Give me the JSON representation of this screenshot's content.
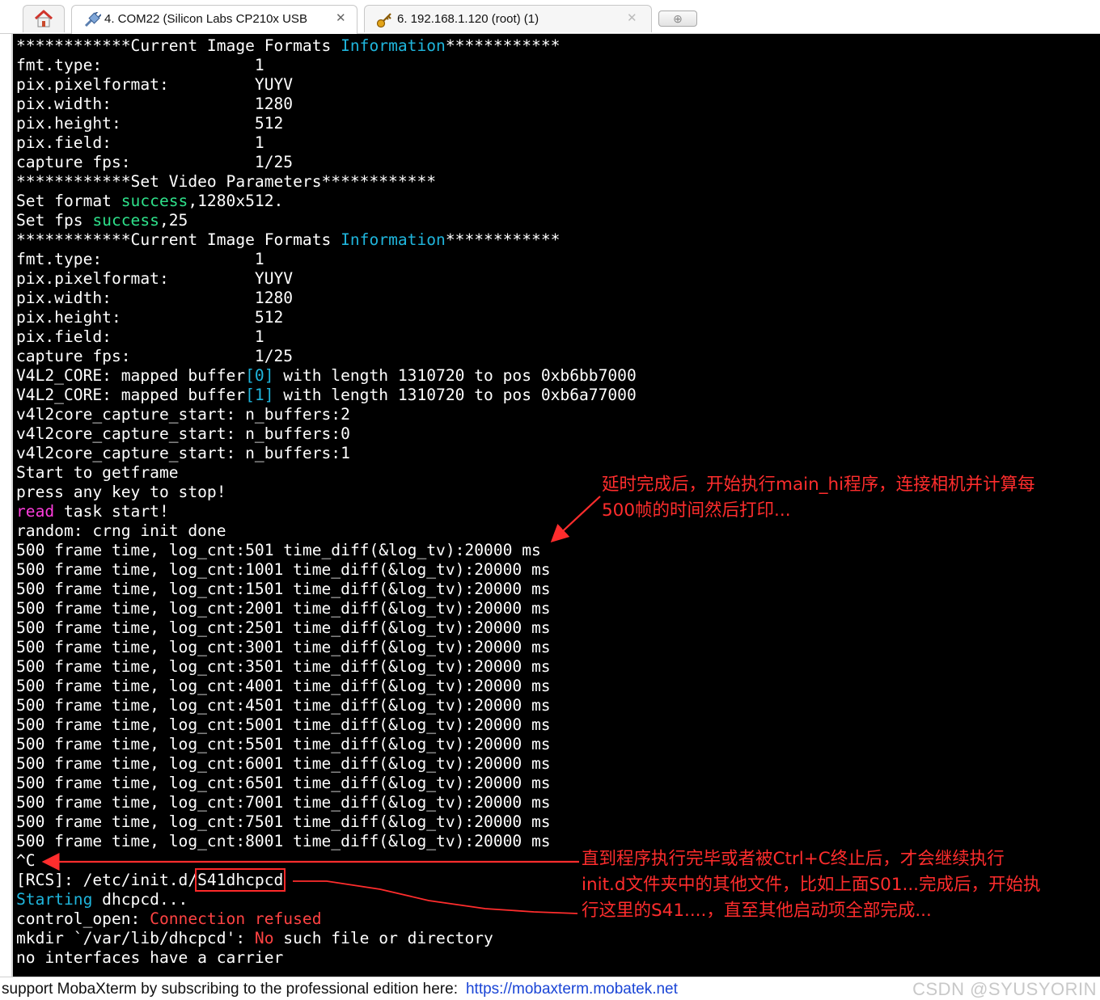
{
  "tabs": {
    "home_icon": "home-icon",
    "items": [
      {
        "label": "4. COM22  (Silicon Labs CP210x USB",
        "icon": "serial-plug-icon",
        "active": true
      },
      {
        "label": "6. 192.168.1.120 (root) (1)",
        "icon": "ssh-key-icon",
        "active": false
      }
    ],
    "close_glyph": "✕",
    "new_tab_glyph": "⊕"
  },
  "terminal": {
    "lines": [
      [
        {
          "t": "************Current Image Formats "
        },
        {
          "t": "Information",
          "c": "cyan"
        },
        {
          "t": "************"
        }
      ],
      [
        {
          "t": "fmt.type:                1"
        }
      ],
      [
        {
          "t": "pix.pixelformat:         YUYV"
        }
      ],
      [
        {
          "t": "pix.width:               1280"
        }
      ],
      [
        {
          "t": "pix.height:              512"
        }
      ],
      [
        {
          "t": "pix.field:               1"
        }
      ],
      [
        {
          "t": "capture fps:             1/25"
        }
      ],
      [
        {
          "t": "************Set Video Parameters************"
        }
      ],
      [
        {
          "t": "Set format "
        },
        {
          "t": "success",
          "c": "green"
        },
        {
          "t": ",1280x512."
        }
      ],
      [
        {
          "t": "Set fps "
        },
        {
          "t": "success",
          "c": "green"
        },
        {
          "t": ",25"
        }
      ],
      [
        {
          "t": "************Current Image Formats "
        },
        {
          "t": "Information",
          "c": "cyan"
        },
        {
          "t": "************"
        }
      ],
      [
        {
          "t": "fmt.type:                1"
        }
      ],
      [
        {
          "t": "pix.pixelformat:         YUYV"
        }
      ],
      [
        {
          "t": "pix.width:               1280"
        }
      ],
      [
        {
          "t": "pix.height:              512"
        }
      ],
      [
        {
          "t": "pix.field:               1"
        }
      ],
      [
        {
          "t": "capture fps:             1/25"
        }
      ],
      [
        {
          "t": "V4L2_CORE: mapped buffer"
        },
        {
          "t": "[0]",
          "c": "cyan"
        },
        {
          "t": " with length 1310720 to pos 0xb6bb7000"
        }
      ],
      [
        {
          "t": "V4L2_CORE: mapped buffer"
        },
        {
          "t": "[1]",
          "c": "cyan"
        },
        {
          "t": " with length 1310720 to pos 0xb6a77000"
        }
      ],
      [
        {
          "t": "v4l2core_capture_start: n_buffers:2"
        }
      ],
      [
        {
          "t": "v4l2core_capture_start: n_buffers:0"
        }
      ],
      [
        {
          "t": "v4l2core_capture_start: n_buffers:1"
        }
      ],
      [
        {
          "t": "Start to getframe"
        }
      ],
      [
        {
          "t": "press any key to stop!"
        }
      ],
      [
        {
          "t": "read",
          "c": "magenta"
        },
        {
          "t": " task start!"
        }
      ],
      [
        {
          "t": "random: crng init done"
        }
      ],
      [
        {
          "t": "500 frame time, log_cnt:501 time_diff(&log_tv):20000 ms"
        }
      ],
      [
        {
          "t": "500 frame time, log_cnt:1001 time_diff(&log_tv):20000 ms"
        }
      ],
      [
        {
          "t": "500 frame time, log_cnt:1501 time_diff(&log_tv):20000 ms"
        }
      ],
      [
        {
          "t": "500 frame time, log_cnt:2001 time_diff(&log_tv):20000 ms"
        }
      ],
      [
        {
          "t": "500 frame time, log_cnt:2501 time_diff(&log_tv):20000 ms"
        }
      ],
      [
        {
          "t": "500 frame time, log_cnt:3001 time_diff(&log_tv):20000 ms"
        }
      ],
      [
        {
          "t": "500 frame time, log_cnt:3501 time_diff(&log_tv):20000 ms"
        }
      ],
      [
        {
          "t": "500 frame time, log_cnt:4001 time_diff(&log_tv):20000 ms"
        }
      ],
      [
        {
          "t": "500 frame time, log_cnt:4501 time_diff(&log_tv):20000 ms"
        }
      ],
      [
        {
          "t": "500 frame time, log_cnt:5001 time_diff(&log_tv):20000 ms"
        }
      ],
      [
        {
          "t": "500 frame time, log_cnt:5501 time_diff(&log_tv):20000 ms"
        }
      ],
      [
        {
          "t": "500 frame time, log_cnt:6001 time_diff(&log_tv):20000 ms"
        }
      ],
      [
        {
          "t": "500 frame time, log_cnt:6501 time_diff(&log_tv):20000 ms"
        }
      ],
      [
        {
          "t": "500 frame time, log_cnt:7001 time_diff(&log_tv):20000 ms"
        }
      ],
      [
        {
          "t": "500 frame time, log_cnt:7501 time_diff(&log_tv):20000 ms"
        }
      ],
      [
        {
          "t": "500 frame time, log_cnt:8001 time_diff(&log_tv):20000 ms"
        }
      ],
      [
        {
          "t": "^C"
        }
      ],
      [
        {
          "t": "[RCS]: /etc/init.d/"
        },
        {
          "t": "S41dhcpcd",
          "box": true
        }
      ],
      [
        {
          "t": "Starting",
          "c": "cyan"
        },
        {
          "t": " dhcpcd..."
        }
      ],
      [
        {
          "t": "control_open: "
        },
        {
          "t": "Connection refused",
          "c": "red"
        }
      ],
      [
        {
          "t": "mkdir `/var/lib/dhcpcd': "
        },
        {
          "t": "No",
          "c": "red"
        },
        {
          "t": " such file or directory"
        }
      ],
      [
        {
          "t": "no interfaces have a carrier"
        }
      ]
    ]
  },
  "annotations": {
    "first": {
      "lines": [
        "延时完成后，开始执行main_hi程序，连接相机并计算每",
        "500帧的时间然后打印..."
      ]
    },
    "second": {
      "lines": [
        "直到程序执行完毕或者被Ctrl+C终止后，才会继续执行",
        "init.d文件夹中的其他文件，比如上面S01...完成后，开始执",
        "行这里的S41....，直至其他启动项全部完成..."
      ]
    },
    "color": "#ff2d2d"
  },
  "status_bar": {
    "text": "support MobaXterm by subscribing to the professional edition here:",
    "link": "https://mobaxterm.mobatek.net",
    "watermark": "CSDN @SYUSYORIN"
  }
}
